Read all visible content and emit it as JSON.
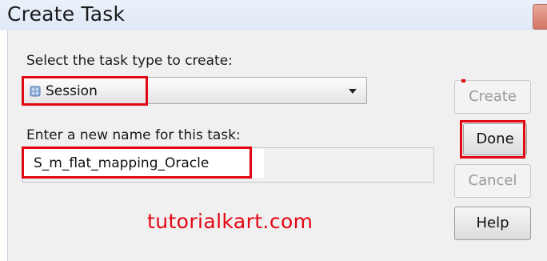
{
  "window": {
    "title": "Create Task"
  },
  "task_type": {
    "label": "Select the task type to create:",
    "selected": "Session",
    "icon": "session-icon"
  },
  "task_name": {
    "label": "Enter a new name for this task:",
    "value": "S_m_flat_mapping_Oracle"
  },
  "buttons": {
    "create_label": "Create",
    "done_label": "Done",
    "cancel_label": "Cancel",
    "help_label": "Help"
  },
  "watermark": "tutorialkart.com",
  "colors": {
    "highlight": "#e30613",
    "watermark": "#e30613"
  }
}
